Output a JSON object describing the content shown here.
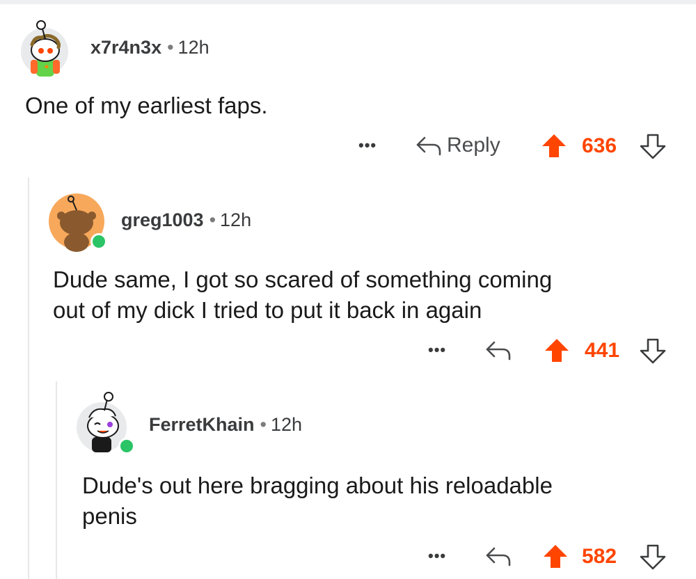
{
  "colors": {
    "upvote": "#ff4500",
    "online": "#2bc467",
    "thread_line": "#e6e7e9"
  },
  "comments": [
    {
      "username": "x7r4n3x",
      "separator": "•",
      "time": "12h",
      "body": "One of my earliest faps.",
      "more": "•••",
      "reply_label": "Reply",
      "votes": "636",
      "avatar": "snoo-avatar-dreadlocks"
    },
    {
      "username": "greg1003",
      "separator": "•",
      "time": "12h",
      "body_lines": [
        "Dude same, I got so scared of something coming",
        "out of my dick I tried to put it back in again"
      ],
      "more": "•••",
      "votes": "441",
      "online": true,
      "avatar": "snoo-avatar-brown"
    },
    {
      "username": "FerretKhain",
      "separator": "•",
      "time": "12h",
      "body_lines": [
        "Dude's out here bragging about his reloadable",
        "penis"
      ],
      "more": "•••",
      "votes": "582",
      "online": true,
      "avatar": "snoo-avatar-winking"
    }
  ]
}
